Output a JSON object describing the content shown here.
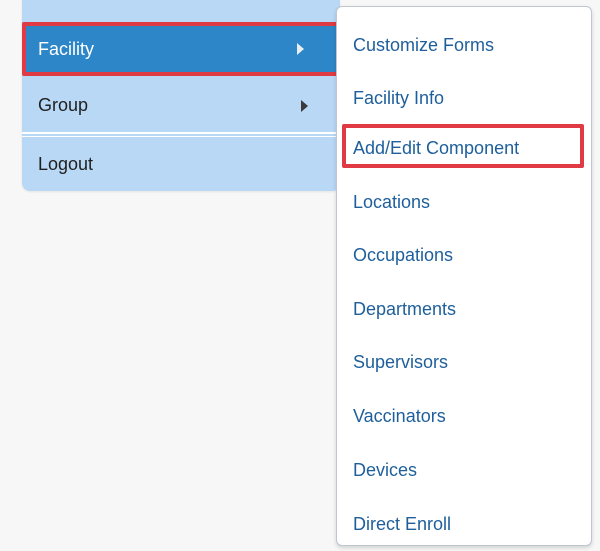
{
  "left_menu": {
    "items": [
      {
        "label": "Facility",
        "has_submenu": true,
        "active": true
      },
      {
        "label": "Group",
        "has_submenu": true
      },
      {
        "label": "Logout",
        "has_submenu": false
      }
    ]
  },
  "submenu": {
    "items": [
      {
        "label": "Customize Forms"
      },
      {
        "label": "Facility Info"
      },
      {
        "label": "Add/Edit Component",
        "highlighted": true
      },
      {
        "label": "Locations"
      },
      {
        "label": "Occupations"
      },
      {
        "label": "Departments"
      },
      {
        "label": "Supervisors"
      },
      {
        "label": "Vaccinators"
      },
      {
        "label": "Devices"
      },
      {
        "label": "Direct Enroll"
      }
    ]
  },
  "colors": {
    "menu_background": "#b9d8f6",
    "active_item": "#2d86c7",
    "highlight_border": "#e03a44",
    "submenu_link": "#1e5f9b"
  },
  "icons": {
    "submenu_arrow": "chevron-right-icon"
  }
}
